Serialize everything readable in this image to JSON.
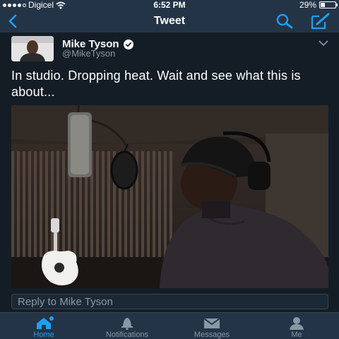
{
  "status_bar": {
    "carrier": "Digicel",
    "time": "6:52 PM",
    "battery": "29%",
    "battery_level": 0.29
  },
  "nav": {
    "title": "Tweet",
    "back_icon": "chevron-left-icon",
    "search_icon": "search-icon",
    "compose_icon": "compose-icon"
  },
  "tweet": {
    "author_name": "Mike Tyson",
    "handle": "@MikeTyson",
    "verified": true,
    "text": "In studio.  Dropping heat. Wait and see what this is about...",
    "media": "photo"
  },
  "reply": {
    "placeholder": "Reply to Mike Tyson"
  },
  "tabs": [
    {
      "label": "Home",
      "icon": "home-icon",
      "active": true
    },
    {
      "label": "Notifications",
      "icon": "bell-icon",
      "active": false
    },
    {
      "label": "Messages",
      "icon": "envelope-icon",
      "active": false
    },
    {
      "label": "Me",
      "icon": "person-icon",
      "active": false
    }
  ],
  "colors": {
    "accent": "#1da1f2",
    "background": "#141d26",
    "bar": "#243447",
    "muted": "#8899a6"
  }
}
